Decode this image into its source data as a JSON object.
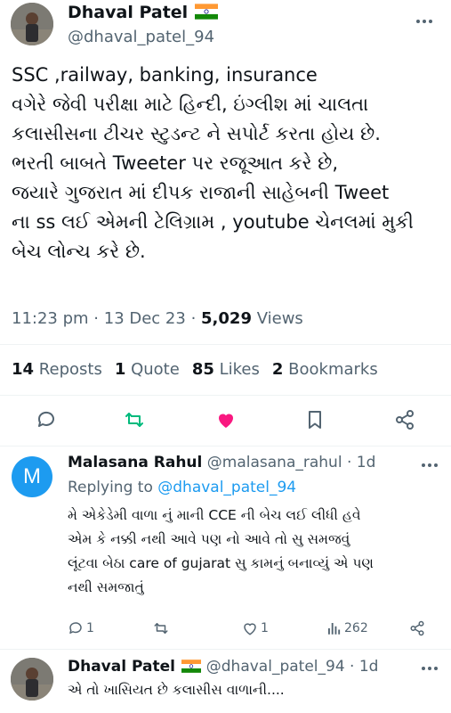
{
  "main_tweet": {
    "author_name": "Dhaval Patel",
    "author_handle": "@dhaval_patel_94",
    "body": "SSC ,railway, banking, insurance\nવગેરે જેવી પરીક્ષા માટે હિન્દી, ઇંગ્લીશ માં ચાલતા\nકલાસીસના ટીચર સ્ટુડન્ટ ને સપોર્ટ કરતા હોય છે.\nભરતી બાબતે Tweeter પર રજૂઆત કરે છે,\nજયારે ગુજરાત માં દીપક રાજાની  સાહેબની Tweet\nના ss લઈ એમની ટેલિગ્રામ , youtube ચેનલમાં મુકી\nબેચ લોન્ચ કરે છે.",
    "time": "11:23 pm",
    "date": "13 Dec 23",
    "views_count": "5,029",
    "views_label": "Views",
    "stats": {
      "reposts_count": "14",
      "reposts_label": "Reposts",
      "quotes_count": "1",
      "quotes_label": "Quote",
      "likes_count": "85",
      "likes_label": "Likes",
      "bookmarks_count": "2",
      "bookmarks_label": "Bookmarks"
    },
    "icons": [
      "reply-icon",
      "repost-icon",
      "like-icon",
      "bookmark-icon",
      "share-icon"
    ],
    "liked": true
  },
  "reply": {
    "avatar_letter": "M",
    "author_name": "Malasana Rahul",
    "author_handle": "@malasana_rahul",
    "age": "1d",
    "replying_label": "Replying to",
    "replying_to": "@dhaval_patel_94",
    "body": "મે એકેડેમી વાળા નું માની CCE ની બેચ લઈ લીધી હવે\nએમ કે નક્કી નથી આવે પણ નો આવે તો સુ સમજવું\nલૂંટવા બેઠા care of gujarat સુ કામનું બનાવ્યું એ પણ\nનથી સમજાતું",
    "replies": "1",
    "likes": "1",
    "views": "262"
  },
  "second_reply": {
    "author_name": "Dhaval Patel",
    "author_handle": "@dhaval_patel_94",
    "age": "1d",
    "body": "એ તો ખાસિયત છે કલાસીસ વાળાની...."
  },
  "colors": {
    "accent": "#1d9bf0",
    "repost_green": "#00ba7c",
    "like_pink": "#f91880",
    "muted": "#536471"
  }
}
